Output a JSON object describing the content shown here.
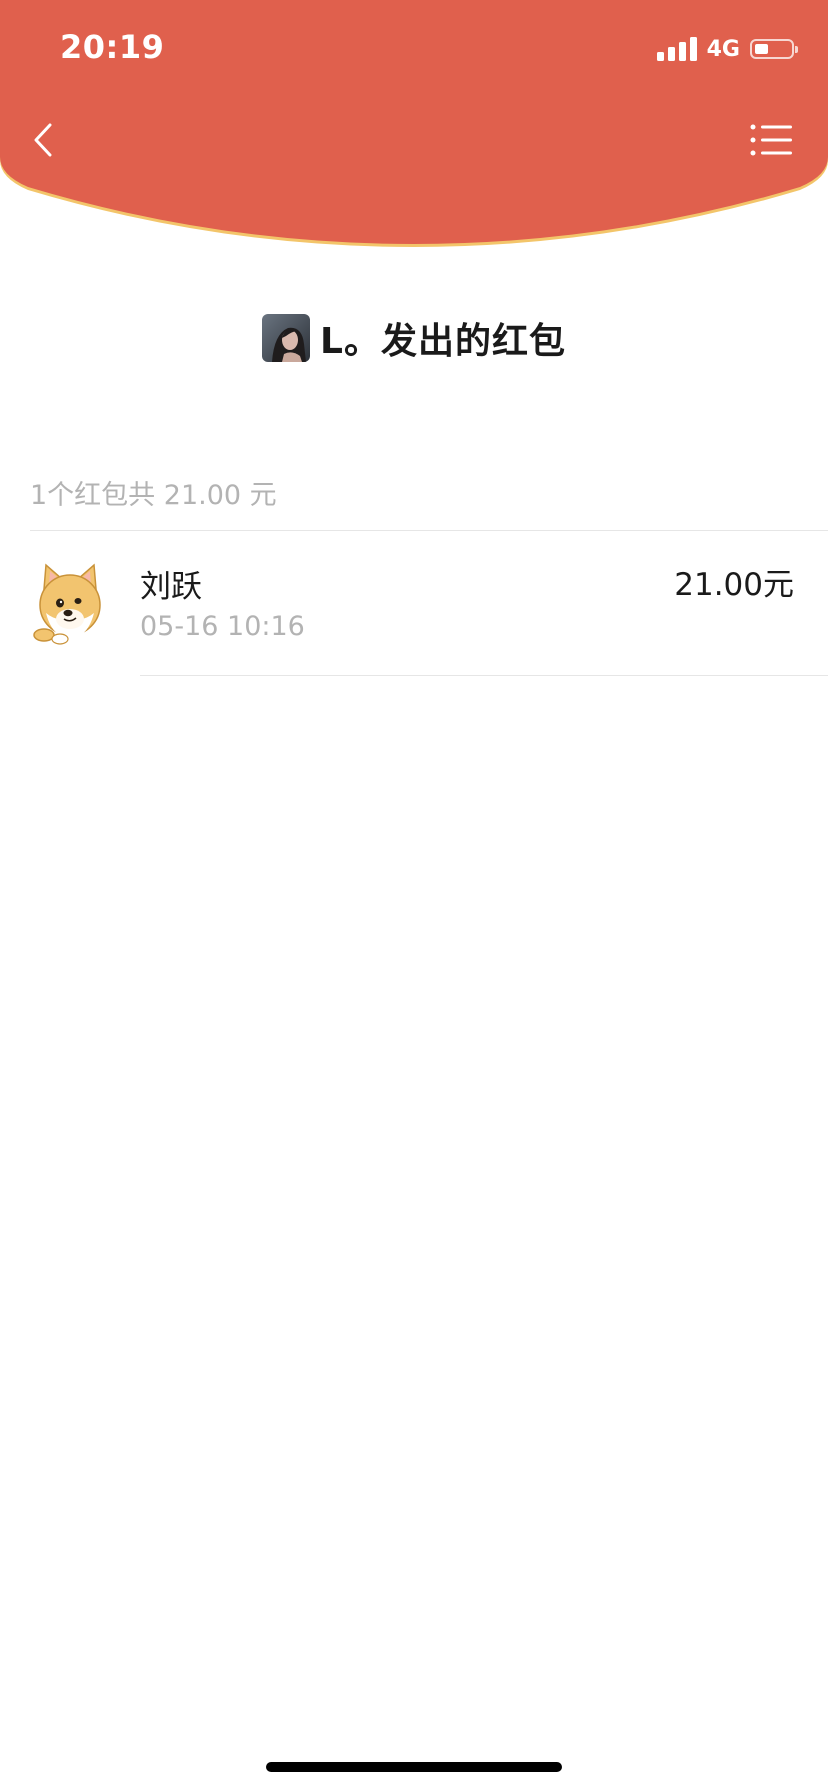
{
  "status_bar": {
    "time": "20:19",
    "network": "4G"
  },
  "colors": {
    "header_red": "#E0604D",
    "header_edge": "#F3C56A",
    "muted_text": "#B3B3B3"
  },
  "nav": {
    "back_icon": "chevron-left-icon",
    "menu_icon": "list-icon"
  },
  "title": {
    "text": "L。发出的红包"
  },
  "summary": {
    "text": "1个红包共 21.00 元"
  },
  "records": [
    {
      "name": "刘跃",
      "time": "05-16 10:16",
      "amount": "21.00元"
    }
  ]
}
